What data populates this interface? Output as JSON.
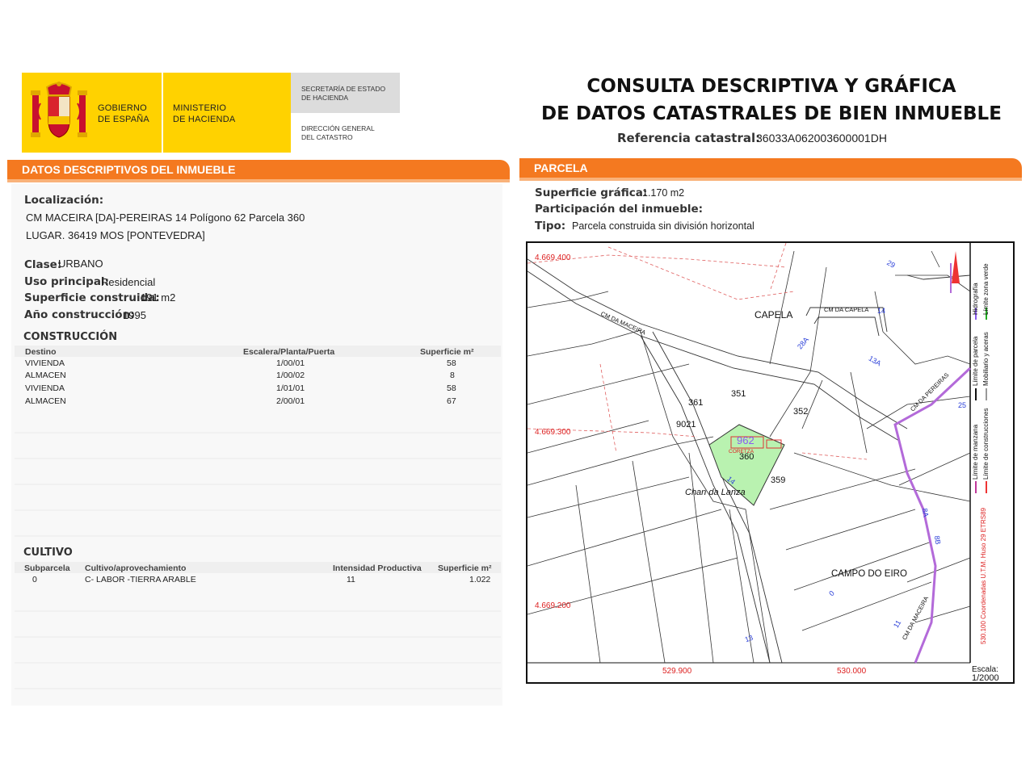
{
  "header": {
    "gov_line1": "GOBIERNO",
    "gov_line2": "DE ESPAÑA",
    "ministry_line1": "MINISTERIO",
    "ministry_line2": "DE HACIENDA",
    "sec_line1": "SECRETARÍA DE ESTADO",
    "sec_line2": "DE HACIENDA",
    "dir_line1": "DIRECCIÓN GENERAL",
    "dir_line2": "DEL CATASTRO",
    "title_line1": "CONSULTA DESCRIPTIVA Y GRÁFICA",
    "title_line2": "DE DATOS CATASTRALES DE BIEN INMUEBLE",
    "ref_label": "Referencia catastral:",
    "ref_value": "36033A062003600001DH"
  },
  "left": {
    "section_title": "DATOS DESCRIPTIVOS DEL INMUEBLE",
    "localizacion_label": "Localización:",
    "address_line1": "CM MACEIRA [DA]-PEREIRAS 14 Polígono 62 Parcela 360",
    "address_line2": "LUGAR. 36419 MOS [PONTEVEDRA]",
    "clase_label": "Clase:",
    "clase_value": "URBANO",
    "uso_label": "Uso principal:",
    "uso_value": "Residencial",
    "sup_label": "Superficie construida:",
    "sup_value": "191 m2",
    "anio_label": "Año construcción:",
    "anio_value": "1995",
    "construccion_title": "CONSTRUCCIÓN",
    "construccion_headers": [
      "Destino",
      "Escalera/Planta/Puerta",
      "Superficie m²"
    ],
    "construccion_rows": [
      [
        "VIVIENDA",
        "1/00/01",
        "58"
      ],
      [
        "ALMACEN",
        "1/00/02",
        "8"
      ],
      [
        "VIVIENDA",
        "1/01/01",
        "58"
      ],
      [
        "ALMACEN",
        "2/00/01",
        "67"
      ]
    ],
    "cultivo_title": "CULTIVO",
    "cultivo_headers": [
      "Subparcela",
      "Cultivo/aprovechamiento",
      "Intensidad Productiva",
      "Superficie m²"
    ],
    "cultivo_rows": [
      [
        "0",
        "C- LABOR -TIERRA ARABLE",
        "11",
        "1.022"
      ]
    ]
  },
  "right": {
    "section_title": "PARCELA",
    "sup_grafica_label": "Superficie gráfica:",
    "sup_grafica_value": "1.170 m2",
    "participacion_label": "Participación del inmueble:",
    "tipo_label": "Tipo:",
    "tipo_value": "Parcela construida sin división horizontal"
  },
  "map": {
    "coord_y1": "4.669.400",
    "coord_y2": "4.669.300",
    "coord_y3": "4.669.200",
    "coord_x1": "529.900",
    "coord_x2": "530.000",
    "road1": "CM DA MACEIRA",
    "road2": "CM DA CAPELA",
    "road3": "CM DA PEREIRAS",
    "road4": "CM DA MACEIRA",
    "place1": "CAPELA",
    "place2": "Chan da Lanza",
    "place3": "CAMPO DO EIRO",
    "parcels": [
      "351",
      "352",
      "361",
      "360",
      "359",
      "9021"
    ],
    "highlight_label": "962",
    "building_label": "CORETZA",
    "numbers_blue": [
      "29",
      "14",
      "28A",
      "13A",
      "25",
      "8A",
      "8B",
      "11",
      "13",
      "14",
      "0"
    ],
    "legend": {
      "hidrografia": "Hidrografía",
      "zona_verde": "Límite zona verde",
      "parcela": "Límite de parcela",
      "mobiliario": "Mobiliario y aceras",
      "manzana": "Límite de manzana",
      "construcciones": "Límite de construcciones",
      "coords": "530.100 Coordenadas U.T.M. Huso 29 ETRS89"
    },
    "scale_label": "Escala:",
    "scale_value": "1/2000"
  },
  "colors": {
    "orange": "#f47920",
    "yellow": "#ffd200",
    "parcel_green": "#b9f2b0",
    "road_purple": "#b36ad9"
  }
}
